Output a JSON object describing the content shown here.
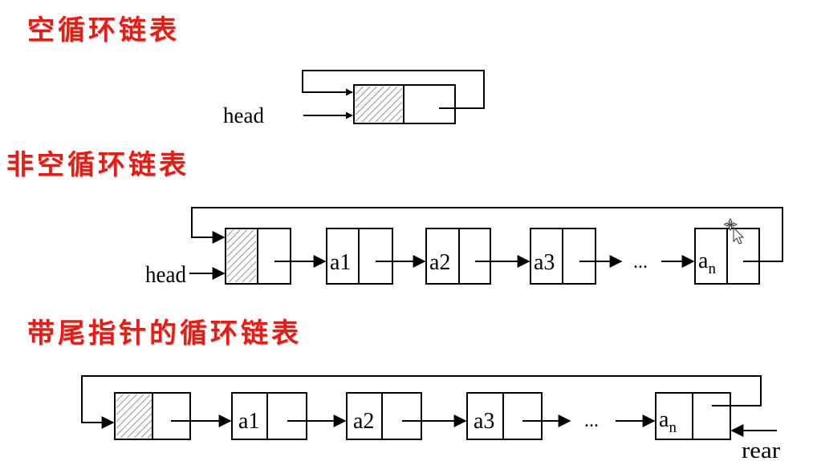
{
  "sections": {
    "empty": {
      "title": "空循环链表",
      "pointer_label": "head"
    },
    "nonempty": {
      "title": "非空循环链表",
      "pointer_label": "head",
      "nodes": [
        "a1",
        "a2",
        "a3"
      ],
      "ellipsis": "...",
      "last_node": {
        "base": "a",
        "sub": "n"
      }
    },
    "tail": {
      "title": "带尾指针的循环链表",
      "pointer_label": "rear",
      "nodes": [
        "a1",
        "a2",
        "a3"
      ],
      "ellipsis": "...",
      "last_node": {
        "base": "a",
        "sub": "n"
      }
    }
  },
  "colors": {
    "heading": "#d8231c",
    "line": "#000000",
    "hatch": "#555555"
  }
}
